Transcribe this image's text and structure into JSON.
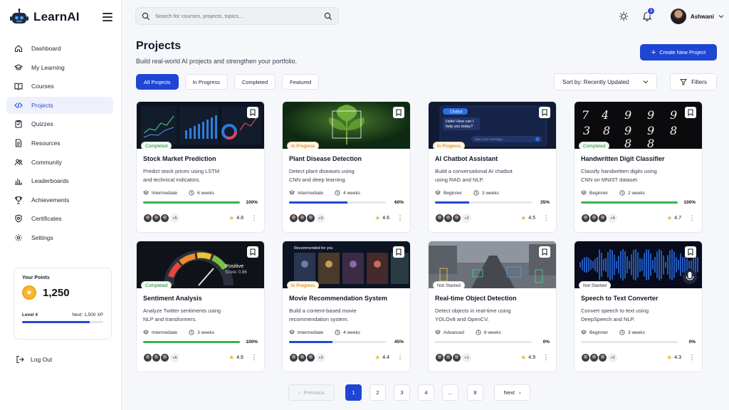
{
  "app": {
    "name": "LearnAI"
  },
  "search": {
    "placeholder": "Search for courses, projects, topics..."
  },
  "notifications": {
    "count": "3"
  },
  "user": {
    "name": "Ashwani"
  },
  "sidebar": {
    "items": [
      {
        "label": "Dashboard",
        "icon": "home-icon"
      },
      {
        "label": "My Learning",
        "icon": "graduation-cap-icon"
      },
      {
        "label": "Courses",
        "icon": "book-icon"
      },
      {
        "label": "Projects",
        "icon": "code-icon",
        "active": true
      },
      {
        "label": "Quizzes",
        "icon": "clipboard-icon"
      },
      {
        "label": "Resources",
        "icon": "document-icon"
      },
      {
        "label": "Community",
        "icon": "users-icon"
      },
      {
        "label": "Leaderboards",
        "icon": "bar-chart-icon"
      },
      {
        "label": "Achievements",
        "icon": "trophy-icon"
      },
      {
        "label": "Certificates",
        "icon": "certificate-icon"
      },
      {
        "label": "Settings",
        "icon": "gear-icon"
      }
    ],
    "points": {
      "label": "Your Points",
      "value": "1,250",
      "level": "Level 4",
      "next": "Next: 1,500 XP",
      "progress": 0.83
    },
    "logout": "Log Out"
  },
  "page": {
    "title": "Projects",
    "subtitle": "Build real-world AI projects and strengthen your portfolio.",
    "create_label": "Create New Project"
  },
  "filters": {
    "tabs": [
      "All Projects",
      "In Progress",
      "Completed",
      "Featured"
    ],
    "active_tab": "All Projects",
    "sort_label": "Sort by: Recently Updated",
    "filters_label": "Filters"
  },
  "colors": {
    "accent": "#1f45d3",
    "completed": "#3bb34a",
    "in_progress": "#2448d6",
    "star": "#f5b82e"
  },
  "projects": [
    {
      "title": "Stock Market Prediction",
      "desc1": "Predict stock prices using LSTM",
      "desc2": "and technical indicators.",
      "level": "Intermediate",
      "duration": "6 weeks",
      "status": "Completed",
      "progress": "100%",
      "extra": "+5",
      "rating": "4.8"
    },
    {
      "title": "Plant Disease Detection",
      "desc1": "Detect plant diseases using",
      "desc2": "CNN and deep learning.",
      "level": "Intermediate",
      "duration": "4 weeks",
      "status": "In Progress",
      "progress": "60%",
      "extra": "+3",
      "rating": "4.6"
    },
    {
      "title": "AI Chatbot Assistant",
      "desc1": "Build a conversational AI chatbot",
      "desc2": "using RAG and NLP.",
      "level": "Beginner",
      "duration": "3 weeks",
      "status": "In Progress",
      "progress": "35%",
      "extra": "+2",
      "rating": "4.5",
      "chat_header": "Chatbot",
      "chat_msg1": "Hello! How can I",
      "chat_msg2": "help you today?",
      "chat_input": "Type your message..."
    },
    {
      "title": "Handwritten Digit Classifier",
      "desc1": "Classify handwritten digits using",
      "desc2": "CNN on MNIST dataset.",
      "level": "Beginner",
      "duration": "2 weeks",
      "status": "Completed",
      "progress": "100%",
      "extra": "+4",
      "rating": "4.7"
    },
    {
      "title": "Sentiment Analysis",
      "desc1": "Analyze Twitter sentiments using",
      "desc2": "NLP and transformers.",
      "level": "Intermediate",
      "duration": "3 weeks",
      "status": "Completed",
      "progress": "100%",
      "extra": "+6",
      "rating": "4.6",
      "sentiment": "Positive",
      "score": "Score: 0.86"
    },
    {
      "title": "Movie Recommendation System",
      "desc1": "Build a content-based movie",
      "desc2": "recommendation system.",
      "level": "Intermediate",
      "duration": "4 weeks",
      "status": "In Progress",
      "progress": "45%",
      "extra": "+3",
      "rating": "4.4",
      "rec_label": "Recommended for you"
    },
    {
      "title": "Real-time Object Detection",
      "desc1": "Detect objects in real-time using",
      "desc2": "YOLOv8 and OpenCV.",
      "level": "Advanced",
      "duration": "6 weeks",
      "status": "Not Started",
      "progress": "0%",
      "extra": "+1",
      "rating": "4.9"
    },
    {
      "title": "Speech to Text Converter",
      "desc1": "Convert speech to text using",
      "desc2": "DeepSpeech and NLP.",
      "level": "Beginner",
      "duration": "3 weeks",
      "status": "Not Started",
      "progress": "0%",
      "extra": "+2",
      "rating": "4.3"
    }
  ],
  "pagination": {
    "previous": "Previous",
    "pages": [
      "1",
      "2",
      "3",
      "4",
      "...",
      "8"
    ],
    "current": "1",
    "next": "Next"
  }
}
